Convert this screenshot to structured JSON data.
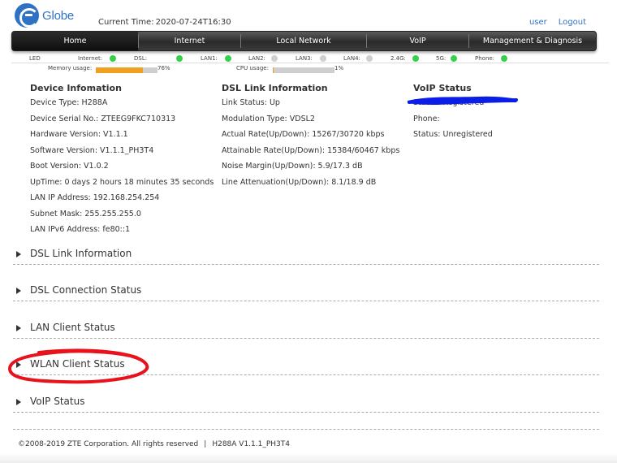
{
  "header": {
    "logo_text": "Globe",
    "current_time_label": "Current Time:",
    "current_time_value": "2020-07-24T16:30",
    "user_link": "user",
    "logout_link": "Logout"
  },
  "nav": {
    "tabs": [
      {
        "label": "Home"
      },
      {
        "label": "Internet"
      },
      {
        "label": "Local Network"
      },
      {
        "label": "VoIP"
      },
      {
        "label": "Management & Diagnosis"
      }
    ],
    "active": "Home"
  },
  "led": {
    "title": "LED",
    "items": [
      {
        "label": "Internet:",
        "state": "on"
      },
      {
        "label": "DSL:",
        "state": "on"
      },
      {
        "label": "LAN1:",
        "state": "on"
      },
      {
        "label": "LAN2:",
        "state": "off"
      },
      {
        "label": "LAN3:",
        "state": "off"
      },
      {
        "label": "LAN4:",
        "state": "off"
      },
      {
        "label": "2.4G:",
        "state": "on"
      },
      {
        "label": "5G:",
        "state": "on"
      },
      {
        "label": "Phone:",
        "state": "on"
      }
    ]
  },
  "usage": {
    "memory_label": "Memory usage:",
    "memory_percent": 76,
    "memory_text": "76%",
    "cpu_label": "CPU usage:",
    "cpu_percent": 1,
    "cpu_text": "1%"
  },
  "device_info": {
    "title": "Device Infomation",
    "rows": [
      "Device Type: H288A",
      "Device Serial No.: ZTEEG9FKC710313",
      "Hardware Version: V1.1.1",
      "Software Version: V1.1.1_PH3T4",
      "Boot Version: V1.0.2",
      "UpTime: 0 days 2 hours 18 minutes 35 seconds",
      "LAN IP Address: 192.168.254.254",
      "Subnet Mask: 255.255.255.0",
      "LAN IPv6 Address: fe80::1"
    ]
  },
  "dsl_info": {
    "title": "DSL Link Information",
    "rows": [
      "Link Status: Up",
      "Modulation Type: VDSL2",
      "Actual Rate(Up/Down): 15267/30720 kbps",
      "Attainable Rate(Up/Down): 15384/60467 kbps",
      "Noise Margin(Up/Down): 5.9/17.3 dB",
      "Line Attenuation(Up/Down): 8.1/18.9 dB"
    ]
  },
  "voip_info": {
    "title": "VoIP Status",
    "rows": [
      "Status: Registered",
      "Phone:",
      "Status: Unregistered"
    ]
  },
  "sections": [
    {
      "label": "DSL Link Information"
    },
    {
      "label": "DSL Connection Status"
    },
    {
      "label": "LAN Client Status"
    },
    {
      "label": "WLAN Client Status"
    },
    {
      "label": "VoIP Status"
    }
  ],
  "footer": {
    "copyright": "©2008-2019 ZTE Corporation. All rights reserved",
    "separator": "|",
    "version": "H288A V1.1.1_PH3T4"
  },
  "colors": {
    "brand_blue": "#2f72c4",
    "led_on": "#36d14a",
    "led_off": "#cfcfcf",
    "memory_bar": "#f0a020",
    "scribble_blue": "#0a1ee8",
    "annotation_red": "#e8121c"
  }
}
